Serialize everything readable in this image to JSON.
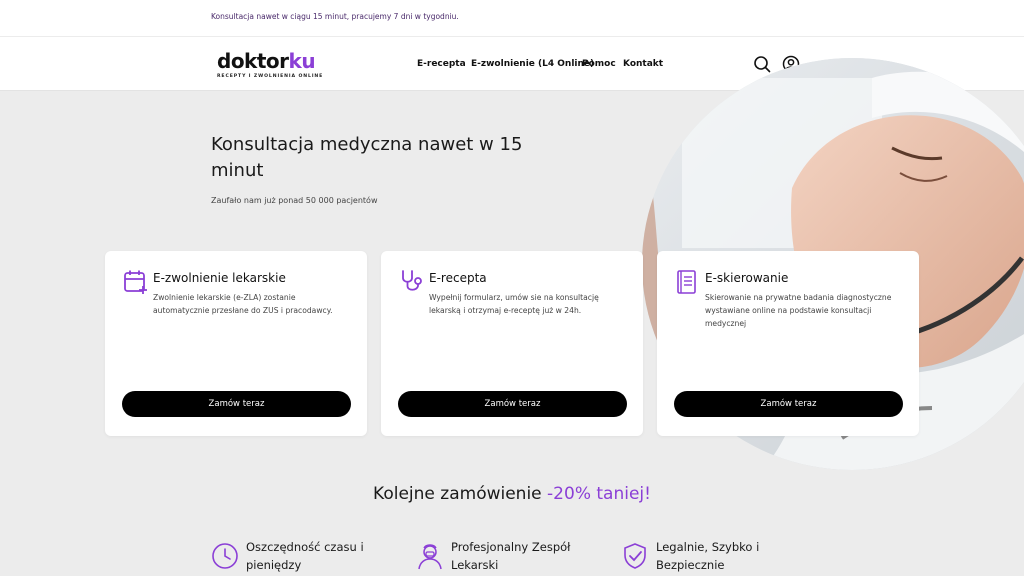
{
  "topbar": {
    "text": "Konsultacja nawet w ciągu 15 minut, pracujemy 7 dni w tygodniu."
  },
  "header": {
    "logo_main_a": "doktor",
    "logo_main_b": "ku",
    "logo_tagline": "RECEPTY I ZWOLNIENIA ONLINE",
    "nav": [
      "E-recepta",
      "E-zwolnienie (L4 Online)",
      "Pomoc",
      "Kontakt"
    ],
    "icons": [
      "search-icon",
      "user-icon"
    ]
  },
  "hero": {
    "title": "Konsultacja medyczna nawet w 15 minut",
    "subtitle": "Zaufało nam już ponad 50 000 pacjentów"
  },
  "cards": [
    {
      "title": "E-zwolnienie lekarskie",
      "desc": "Zwolnienie lekarskie (e-ZLA) zostanie automatycznie przesłane do ZUS i pracodawcy.",
      "button": "Zamów teraz",
      "icon": "calendar-plus-icon"
    },
    {
      "title": "E-recepta",
      "desc": "Wypełnij formularz, umów sie na konsultację lekarską i otrzymaj e-receptę już w 24h.",
      "button": "Zamów teraz",
      "icon": "stethoscope-icon"
    },
    {
      "title": "E-skierowanie",
      "desc": "Skierowanie na prywatne badania diagnostyczne wystawiane online na podstawie konsultacji medycznej",
      "button": "Zamów teraz",
      "icon": "document-icon"
    }
  ],
  "promo": {
    "text": "Kolejne zamówienie ",
    "highlight": "-20% taniej!"
  },
  "features": [
    {
      "line1": "Oszczędność czasu i",
      "line2": "pieniędzy",
      "icon": "clock-icon"
    },
    {
      "line1": "Profesjonalny Zespół",
      "line2": "Lekarski",
      "icon": "doctor-icon"
    },
    {
      "line1": "Legalnie, Szybko i",
      "line2": "Bezpiecznie",
      "icon": "shield-check-icon"
    }
  ],
  "colors": {
    "accent": "#8b3fd6",
    "background": "#ececec",
    "button": "#000000"
  }
}
